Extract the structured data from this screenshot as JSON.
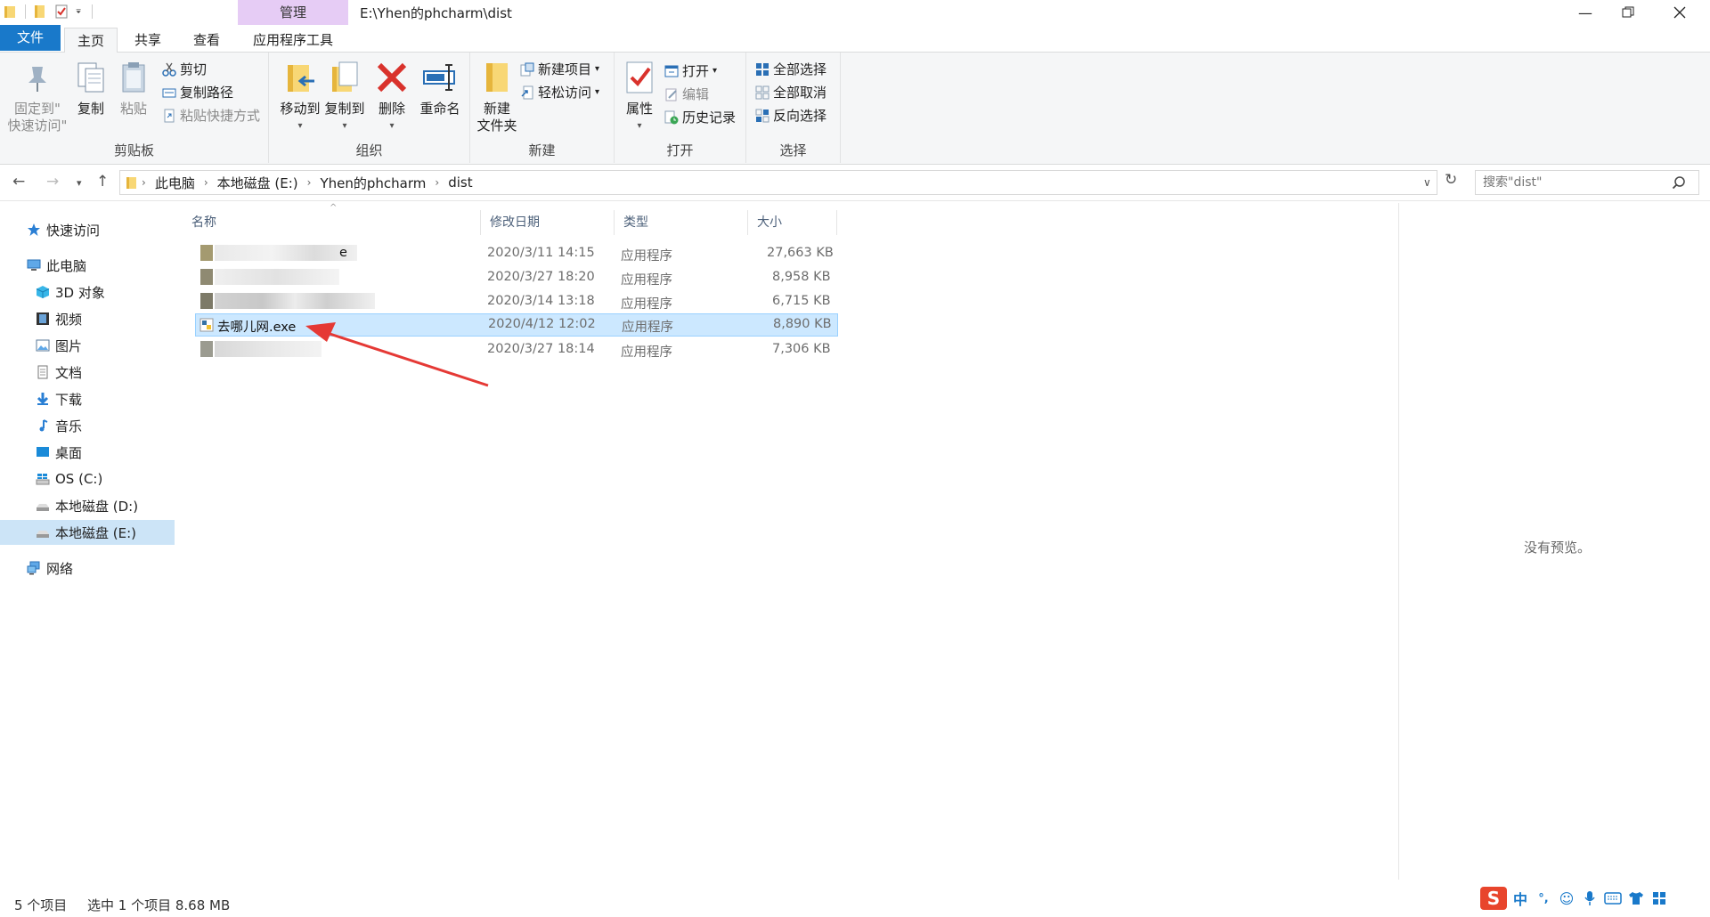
{
  "window": {
    "title": "E:\\Yhen的phcharm\\dist",
    "manage_tab": "管理"
  },
  "tabs": {
    "file": "文件",
    "home": "主页",
    "share": "共享",
    "view": "查看",
    "app_tools": "应用程序工具"
  },
  "ribbon": {
    "clipboard": {
      "label": "剪贴板",
      "pin_line1": "固定到\"",
      "pin_line2": "快速访问\"",
      "copy": "复制",
      "paste": "粘贴",
      "cut": "剪切",
      "copy_path": "复制路径",
      "paste_shortcut": "粘贴快捷方式"
    },
    "organize": {
      "label": "组织",
      "move_to": "移动到",
      "copy_to": "复制到",
      "delete": "删除",
      "rename": "重命名"
    },
    "new": {
      "label": "新建",
      "new_folder_line1": "新建",
      "new_folder_line2": "文件夹",
      "new_item": "新建项目",
      "easy_access": "轻松访问"
    },
    "open": {
      "label": "打开",
      "properties": "属性",
      "open": "打开",
      "edit": "编辑",
      "history": "历史记录"
    },
    "select": {
      "label": "选择",
      "select_all": "全部选择",
      "select_none": "全部取消",
      "invert": "反向选择"
    }
  },
  "address": {
    "crumbs": [
      "此电脑",
      "本地磁盘 (E:)",
      "Yhen的phcharm",
      "dist"
    ],
    "search_placeholder": "搜索\"dist\""
  },
  "sidebar": {
    "quick_access": "快速访问",
    "this_pc": "此电脑",
    "items": [
      "3D 对象",
      "视频",
      "图片",
      "文档",
      "下载",
      "音乐",
      "桌面",
      "OS (C:)",
      "本地磁盘 (D:)",
      "本地磁盘 (E:)"
    ],
    "network": "网络"
  },
  "columns": {
    "name": "名称",
    "modified": "修改日期",
    "type": "类型",
    "size": "大小"
  },
  "files": [
    {
      "name": "e",
      "modified": "2020/3/11 14:15",
      "type": "应用程序",
      "size": "27,663 KB",
      "blurred": true
    },
    {
      "name": "",
      "modified": "2020/3/27 18:20",
      "type": "应用程序",
      "size": "8,958 KB",
      "blurred": true
    },
    {
      "name": "",
      "modified": "2020/3/14 13:18",
      "type": "应用程序",
      "size": "6,715 KB",
      "blurred": true
    },
    {
      "name": "去哪儿网.exe",
      "modified": "2020/4/12 12:02",
      "type": "应用程序",
      "size": "8,890 KB",
      "blurred": false,
      "selected": true
    },
    {
      "name": "",
      "modified": "2020/3/27 18:14",
      "type": "应用程序",
      "size": "7,306 KB",
      "blurred": true
    }
  ],
  "preview": {
    "text": "没有预览。"
  },
  "status": {
    "count": "5 个项目",
    "selection": "选中 1 个项目  8.68 MB"
  },
  "ime": {
    "lang": "中",
    "punct": "°,"
  }
}
